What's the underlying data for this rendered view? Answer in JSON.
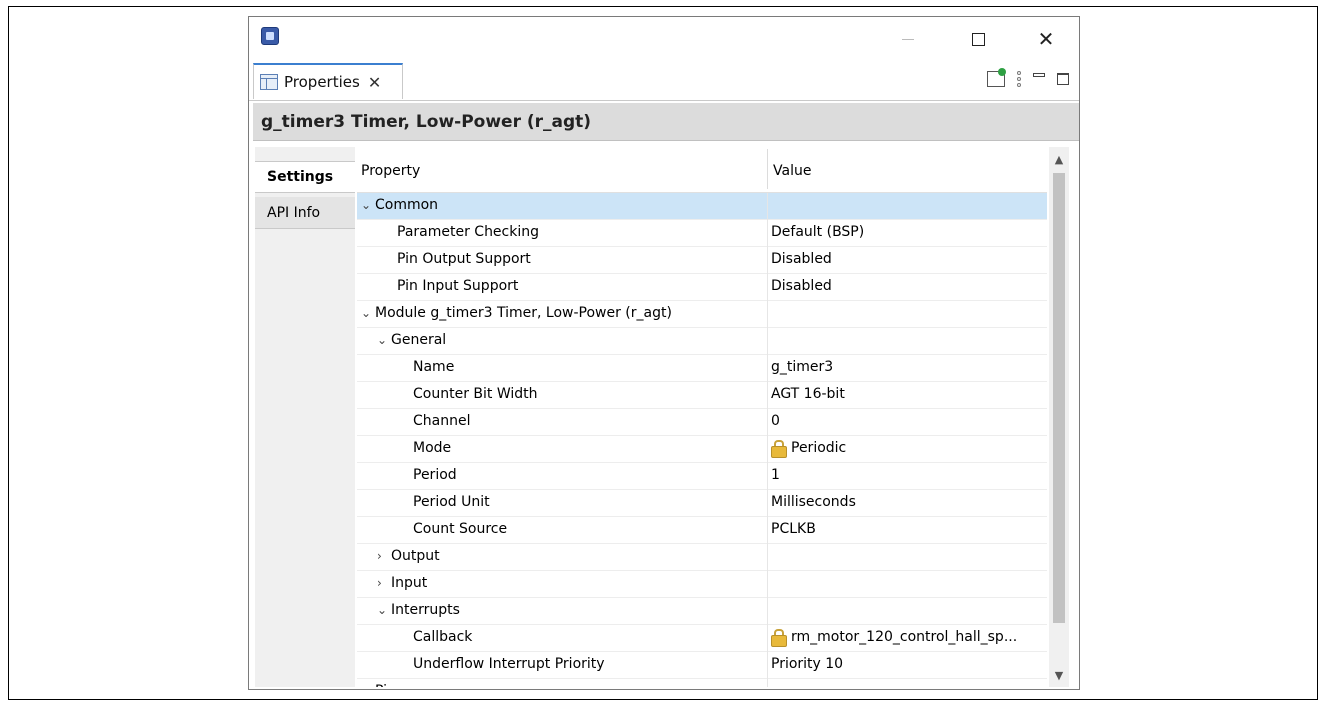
{
  "tab": {
    "label": "Properties"
  },
  "panel": {
    "title": "g_timer3 Timer, Low-Power (r_agt)"
  },
  "side_tabs": [
    "Settings",
    "API Info"
  ],
  "table": {
    "headers": {
      "property": "Property",
      "value": "Value"
    },
    "rows": [
      {
        "indent": 0,
        "expander": "open",
        "property": "Common",
        "value": "",
        "selected": true
      },
      {
        "indent": 2,
        "expander": "none",
        "property": "Parameter Checking",
        "value": "Default (BSP)"
      },
      {
        "indent": 2,
        "expander": "none",
        "property": "Pin Output Support",
        "value": "Disabled"
      },
      {
        "indent": 2,
        "expander": "none",
        "property": "Pin Input Support",
        "value": "Disabled"
      },
      {
        "indent": 0,
        "expander": "open",
        "property": "Module g_timer3 Timer, Low-Power (r_agt)",
        "value": ""
      },
      {
        "indent": 1,
        "expander": "open",
        "property": "General",
        "value": ""
      },
      {
        "indent": 3,
        "expander": "none",
        "property": "Name",
        "value": "g_timer3"
      },
      {
        "indent": 3,
        "expander": "none",
        "property": "Counter Bit Width",
        "value": "AGT 16-bit"
      },
      {
        "indent": 3,
        "expander": "none",
        "property": "Channel",
        "value": "0"
      },
      {
        "indent": 3,
        "expander": "none",
        "property": "Mode",
        "value": "Periodic",
        "locked": true
      },
      {
        "indent": 3,
        "expander": "none",
        "property": "Period",
        "value": "1"
      },
      {
        "indent": 3,
        "expander": "none",
        "property": "Period Unit",
        "value": "Milliseconds"
      },
      {
        "indent": 3,
        "expander": "none",
        "property": "Count Source",
        "value": "PCLKB"
      },
      {
        "indent": 1,
        "expander": "closed",
        "property": "Output",
        "value": ""
      },
      {
        "indent": 1,
        "expander": "closed",
        "property": "Input",
        "value": ""
      },
      {
        "indent": 1,
        "expander": "open",
        "property": "Interrupts",
        "value": ""
      },
      {
        "indent": 3,
        "expander": "none",
        "property": "Callback",
        "value": "rm_motor_120_control_hall_sp...",
        "locked": true
      },
      {
        "indent": 3,
        "expander": "none",
        "property": "Underflow Interrupt Priority",
        "value": "Priority 10"
      },
      {
        "indent": 0,
        "expander": "closed",
        "property": "Pi",
        "value": ""
      }
    ]
  }
}
